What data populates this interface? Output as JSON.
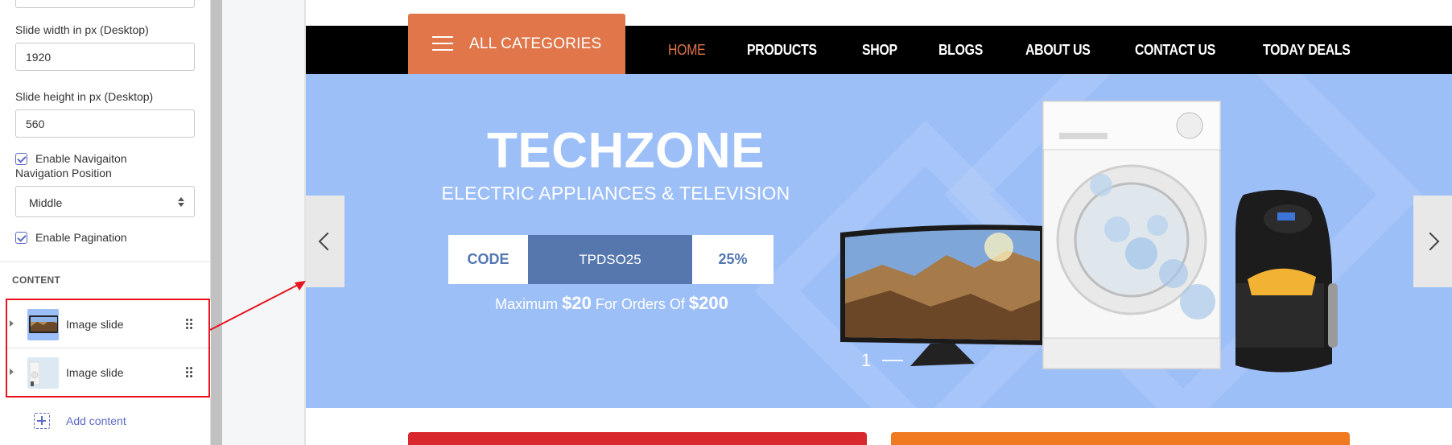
{
  "sidebar": {
    "fields": [
      {
        "label": "Slide width in px (Desktop)",
        "value": "1920"
      },
      {
        "label": "Slide height in px (Desktop)",
        "value": "560"
      }
    ],
    "enable_navigation": {
      "label": "Enable Navigaiton",
      "checked": true
    },
    "navigation_position": {
      "label": "Navigation Position",
      "value": "Middle"
    },
    "enable_pagination": {
      "label": "Enable Pagination",
      "checked": true
    },
    "content_header": "CONTENT",
    "blocks": [
      {
        "label": "Image slide",
        "thumb": "tv-thumbnail"
      },
      {
        "label": "Image slide",
        "thumb": "appliance-thumbnail"
      }
    ],
    "add_content": "Add content",
    "accent_color": "#5c6ac4"
  },
  "store": {
    "all_categories": "ALL CATEGORIES",
    "menu": [
      "HOME",
      "PRODUCTS",
      "SHOP",
      "BLOGS",
      "ABOUT US",
      "CONTACT US",
      "TODAY DEALS"
    ],
    "active_menu": "HOME",
    "accent_color": "#e0764a",
    "banner": {
      "headline": "TECHZONE",
      "subline": "ELECTRIC APPLIANCES & TELEVISION",
      "coupon": {
        "code_label": "CODE",
        "code": "TPDSO25",
        "discount": "25%"
      },
      "max_prefix": "Maximum ",
      "max_amount": "$20",
      "max_mid": " For Orders Of ",
      "max_order": "$200",
      "page_number": "1",
      "background_color": "#9dbff8"
    }
  },
  "annotation_color": "#e8141f"
}
